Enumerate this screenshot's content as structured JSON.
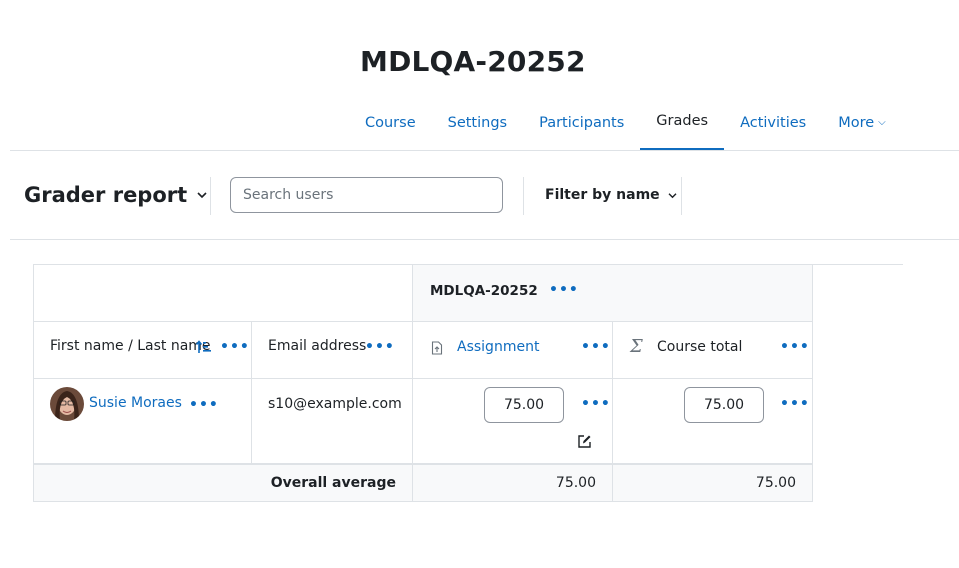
{
  "page": {
    "title": "MDLQA-20252"
  },
  "nav": {
    "items": [
      {
        "label": "Course"
      },
      {
        "label": "Settings"
      },
      {
        "label": "Participants"
      },
      {
        "label": "Grades"
      },
      {
        "label": "Activities"
      },
      {
        "label": "More"
      }
    ],
    "active": "Grades"
  },
  "report": {
    "title": "Grader report",
    "search_placeholder": "Search users",
    "filter_label": "Filter by name"
  },
  "table": {
    "category_header": "MDLQA-20252",
    "columns": {
      "name": "First name / Last name",
      "email": "Email address",
      "assignment": "Assignment",
      "course_total": "Course total"
    },
    "rows": [
      {
        "name": "Susie Moraes",
        "email": "s10@example.com",
        "assignment": "75.00",
        "course_total": "75.00"
      }
    ],
    "overall_label": "Overall average",
    "overall_assignment": "75.00",
    "overall_total": "75.00"
  }
}
